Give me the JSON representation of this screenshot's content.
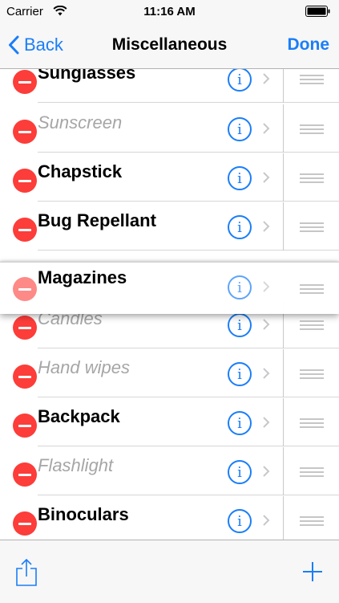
{
  "status_bar": {
    "carrier": "Carrier",
    "time": "11:16 AM"
  },
  "nav": {
    "back_label": "Back",
    "title": "Miscellaneous",
    "done_label": "Done"
  },
  "items": [
    {
      "label": "Sunglasses",
      "checked": true
    },
    {
      "label": "Sunscreen",
      "checked": false
    },
    {
      "label": "Chapstick",
      "checked": true
    },
    {
      "label": "Bug Repellant",
      "checked": true
    },
    {
      "label": "Candles",
      "checked": false
    },
    {
      "label": "Hand wipes",
      "checked": false
    },
    {
      "label": "Backpack",
      "checked": true
    },
    {
      "label": "Flashlight",
      "checked": false
    },
    {
      "label": "Binoculars",
      "checked": true
    }
  ],
  "dragged_item": {
    "label": "Magazines",
    "checked": true
  },
  "colors": {
    "accent": "#1a7ef8",
    "delete": "#fc3d39",
    "dimmed_text": "#a6a6a6"
  },
  "icons": {
    "row_info": "info-icon",
    "row_disclosure": "chevron-right-icon",
    "row_reorder": "reorder-grip-icon",
    "row_delete": "delete-minus-icon",
    "toolbar_share": "share-icon",
    "toolbar_add": "plus-icon"
  }
}
